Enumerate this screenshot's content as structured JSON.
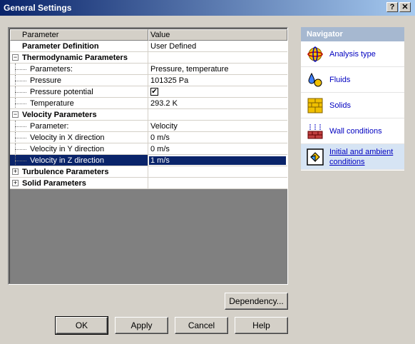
{
  "window": {
    "title": "General Settings",
    "help_button": "?",
    "close_button": "✕"
  },
  "grid": {
    "headers": {
      "parameter": "Parameter",
      "value": "Value"
    },
    "rows": [
      {
        "kind": "plain",
        "label": "Parameter Definition",
        "value": "User Defined"
      },
      {
        "kind": "group",
        "expander": "−",
        "label": "Thermodynamic Parameters",
        "value": ""
      },
      {
        "kind": "child",
        "label": "Parameters:",
        "value": "Pressure, temperature"
      },
      {
        "kind": "child",
        "label": "Pressure",
        "value": "101325 Pa"
      },
      {
        "kind": "child",
        "label": "Pressure potential",
        "value": "✔",
        "checkbox": true
      },
      {
        "kind": "child",
        "label": "Temperature",
        "value": "293.2 K"
      },
      {
        "kind": "group",
        "expander": "−",
        "label": "Velocity Parameters",
        "value": ""
      },
      {
        "kind": "child",
        "label": "Parameter:",
        "value": "Velocity"
      },
      {
        "kind": "child",
        "label": "Velocity in X direction",
        "value": "0 m/s"
      },
      {
        "kind": "child",
        "label": "Velocity in Y direction",
        "value": "0 m/s"
      },
      {
        "kind": "child",
        "label": "Velocity in Z direction",
        "value": "1 m/s",
        "selected": true
      },
      {
        "kind": "group",
        "expander": "+",
        "label": "Turbulence Parameters",
        "value": ""
      },
      {
        "kind": "group",
        "expander": "+",
        "label": "Solid Parameters",
        "value": ""
      }
    ]
  },
  "navigator": {
    "title": "Navigator",
    "items": [
      {
        "label": "Analysis type",
        "icon": "analysis-type-icon"
      },
      {
        "label": "Fluids",
        "icon": "fluids-icon"
      },
      {
        "label": "Solids",
        "icon": "solids-icon"
      },
      {
        "label": "Wall conditions",
        "icon": "wall-conditions-icon"
      },
      {
        "label": "Initial and ambient conditions",
        "icon": "initial-conditions-icon",
        "active": true
      }
    ]
  },
  "buttons": {
    "dependency": "Dependency...",
    "ok": "OK",
    "apply": "Apply",
    "cancel": "Cancel",
    "help": "Help"
  }
}
